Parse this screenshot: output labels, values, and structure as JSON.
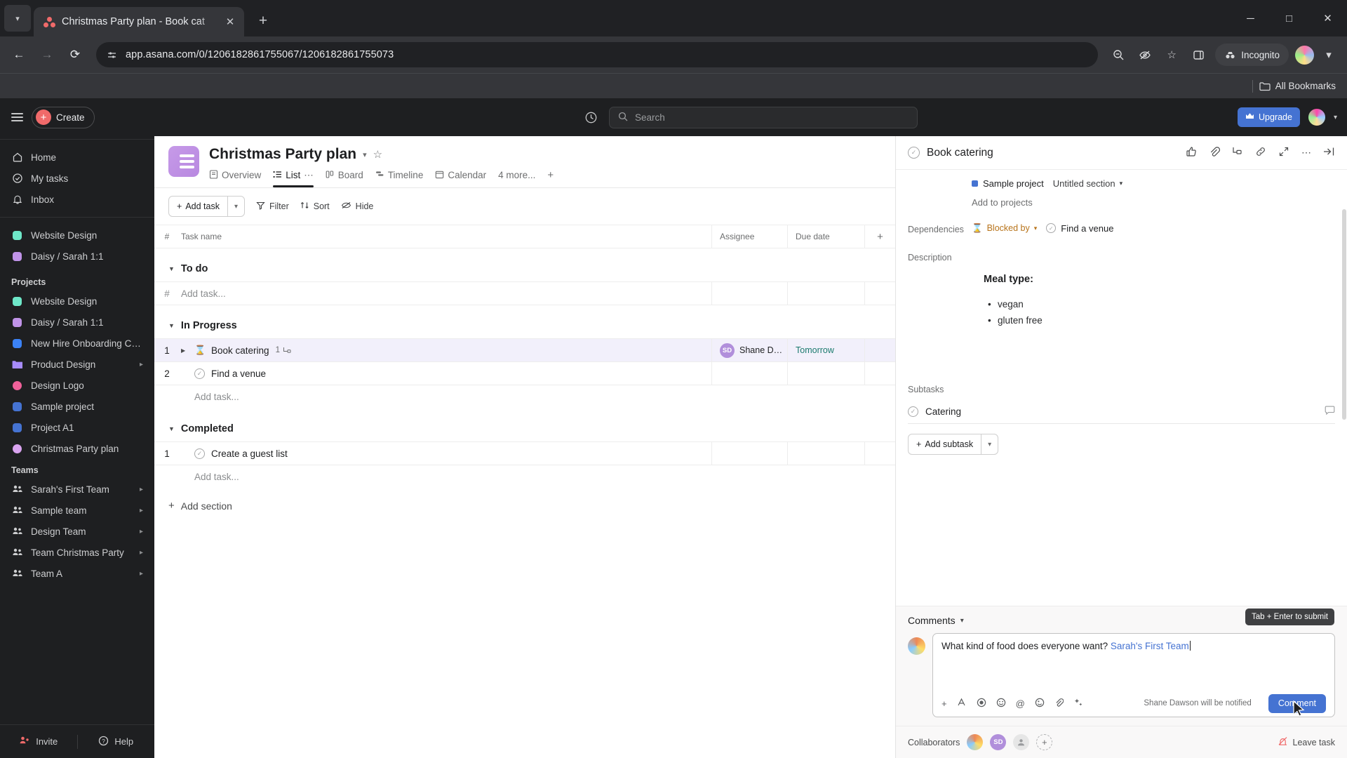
{
  "browser": {
    "tab_title": "Christmas Party plan - Book cat",
    "url": "app.asana.com/0/1206182861755067/1206182861755073",
    "incognito_label": "Incognito",
    "bookmarks_label": "All Bookmarks",
    "new_tab_label": "+",
    "close_tab_label": "✕",
    "minimize_label": "─",
    "maximize_label": "□",
    "close_label": "✕",
    "back_label": "←",
    "forward_label": "→",
    "reload_label": "⟳"
  },
  "sidebar": {
    "create_label": "Create",
    "nav": [
      {
        "label": "Home",
        "icon": "home-icon"
      },
      {
        "label": "My tasks",
        "icon": "check-circle-icon"
      },
      {
        "label": "Inbox",
        "icon": "bell-icon"
      }
    ],
    "favorites": [
      {
        "label": "Website Design",
        "color": "#6ee7c8",
        "locked": false
      },
      {
        "label": "Daisy / Sarah 1:1",
        "color": "#c093e8",
        "locked": true
      }
    ],
    "projects_heading": "Projects",
    "projects": [
      {
        "label": "Website Design",
        "color": "#6ee7c8",
        "locked": false,
        "chevron": false
      },
      {
        "label": "Daisy / Sarah 1:1",
        "color": "#c093e8",
        "locked": true,
        "chevron": false
      },
      {
        "label": "New Hire Onboarding Ch...",
        "color": "#3b82f6",
        "locked": false,
        "chevron": false
      },
      {
        "label": "Product Design",
        "color": "#a78bfa",
        "locked": false,
        "chevron": true
      },
      {
        "label": "Design Logo",
        "color": "#f0619a",
        "locked": false,
        "chevron": false
      },
      {
        "label": "Sample project",
        "color": "#4573d2",
        "locked": false,
        "chevron": false
      },
      {
        "label": "Project A1",
        "color": "#4573d2",
        "locked": false,
        "chevron": false
      },
      {
        "label": "Christmas Party plan",
        "color": "#d9a3ef",
        "locked": false,
        "chevron": false
      }
    ],
    "teams_heading": "Teams",
    "teams": [
      {
        "label": "Sarah's First Team",
        "chevron": true
      },
      {
        "label": "Sample team",
        "chevron": true
      },
      {
        "label": "Design Team",
        "chevron": true
      },
      {
        "label": "Team Christmas Party",
        "chevron": true
      },
      {
        "label": "Team A",
        "chevron": true
      }
    ],
    "invite_label": "Invite",
    "help_label": "Help"
  },
  "topbar": {
    "search_placeholder": "Search",
    "upgrade_label": "Upgrade"
  },
  "project": {
    "title": "Christmas Party plan",
    "tabs": [
      {
        "label": "Overview",
        "icon": "overview-icon",
        "active": false
      },
      {
        "label": "List",
        "icon": "list-icon",
        "active": true
      },
      {
        "label": "Board",
        "icon": "board-icon",
        "active": false
      },
      {
        "label": "Timeline",
        "icon": "timeline-icon",
        "active": false
      },
      {
        "label": "Calendar",
        "icon": "calendar-icon",
        "active": false
      },
      {
        "label": "4 more...",
        "icon": "",
        "active": false
      }
    ],
    "add_tab_label": "+"
  },
  "list_toolbar": {
    "add_task_label": "Add task",
    "filter_label": "Filter",
    "sort_label": "Sort",
    "hide_label": "Hide"
  },
  "table": {
    "columns": {
      "num": "#",
      "task_name": "Task name",
      "assignee": "Assignee",
      "due_date": "Due date",
      "add": "+"
    },
    "add_task_placeholder": "Add task...",
    "sections": [
      {
        "name": "To do",
        "tasks": [],
        "show_empty_row": true
      },
      {
        "name": "In Progress",
        "tasks": [
          {
            "num": "1",
            "name": "Book catering",
            "subtask_count": "1",
            "assignee": "Shane Daws...",
            "assignee_initials": "SD",
            "due": "Tomorrow",
            "status_icon": "hourglass-icon",
            "selected": true,
            "expandable": true
          },
          {
            "num": "2",
            "name": "Find a venue",
            "subtask_count": "",
            "assignee": "",
            "assignee_initials": "",
            "due": "",
            "status_icon": "check-circle-icon",
            "selected": false,
            "expandable": false
          }
        ],
        "show_empty_row": false
      },
      {
        "name": "Completed",
        "tasks": [
          {
            "num": "1",
            "name": "Create a guest list",
            "subtask_count": "",
            "assignee": "",
            "assignee_initials": "",
            "due": "",
            "status_icon": "check-circle-icon",
            "selected": false,
            "expandable": false
          }
        ],
        "show_empty_row": false
      }
    ],
    "add_section_label": "Add section"
  },
  "detail": {
    "title": "Book catering",
    "project_chip": "Sample project",
    "section_select": "Untitled section",
    "add_to_projects": "Add to projects",
    "dependencies_label": "Dependencies",
    "blocked_by_label": "Blocked by",
    "blocked_by_task": "Find a venue",
    "description_label": "Description",
    "description_heading": "Meal type:",
    "description_items": [
      "vegan",
      "gluten free"
    ],
    "subtasks_label": "Subtasks",
    "subtasks": [
      "Catering"
    ],
    "add_subtask_label": "Add subtask",
    "comments_label": "Comments",
    "comment_text": "What kind of food does everyone want? ",
    "comment_mention": "Sarah's First Team",
    "tooltip": "Tab + Enter to submit",
    "notify_text": "Shane Dawson will be notified",
    "comment_button": "Comment",
    "collaborators_label": "Collaborators",
    "collaborator_initials": "SD",
    "add_collaborator": "+",
    "leave_task_label": "Leave task"
  }
}
